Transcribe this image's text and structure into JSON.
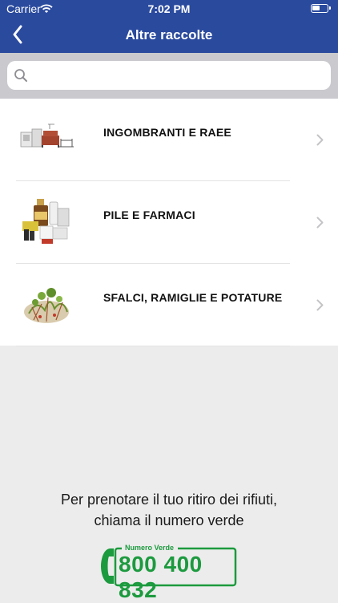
{
  "status_bar": {
    "carrier": "Carrier",
    "time": "7:02 PM"
  },
  "nav": {
    "title": "Altre raccolte",
    "back_icon": "chevron-left-icon"
  },
  "search": {
    "placeholder": "",
    "value": ""
  },
  "items": [
    {
      "label": "INGOMBRANTI E RAEE",
      "icon": "furniture-appliances-image"
    },
    {
      "label": "PILE E FARMACI",
      "icon": "batteries-medicines-image"
    },
    {
      "label": "SFALCI, RAMIGLIE E POTATURE",
      "icon": "grass-clippings-image"
    }
  ],
  "footer": {
    "line1": "Per prenotare il tuo ritiro dei rifiuti,",
    "line2": "chiama il numero verde",
    "badge_label": "Numero Verde",
    "badge_number": "800 400 832"
  },
  "colors": {
    "header": "#2a4a9e",
    "green": "#1c9a3e",
    "background": "#ececec"
  }
}
